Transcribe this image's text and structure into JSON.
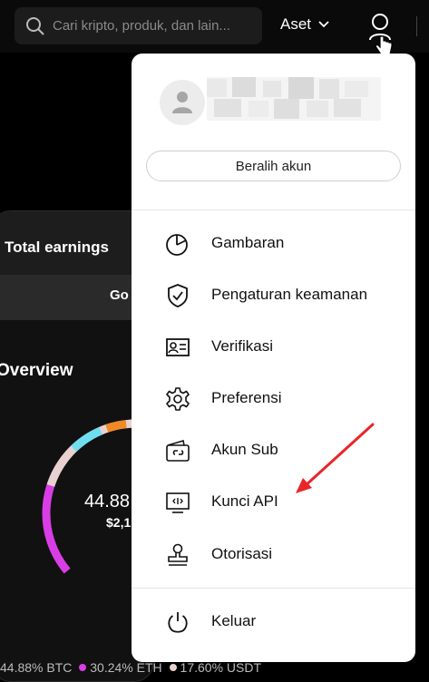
{
  "header": {
    "search_placeholder": "Cari kripto, produk, dan lain...",
    "assets_label": "Aset"
  },
  "background_card": {
    "title": "Total earnings",
    "go_label": "Go",
    "overview_label": "Overview",
    "center_percent": "44.88",
    "center_value": "$2,1",
    "legend": [
      {
        "label": "44.88% BTC",
        "color": "#e8d2cf"
      },
      {
        "label": "30.24% ETH",
        "color": "#d83ee6"
      },
      {
        "label": "17.60% USDT",
        "color": "#e8d2cf"
      }
    ]
  },
  "account_menu": {
    "switch_account_label": "Beralih akun",
    "items": [
      {
        "label": "Gambaran",
        "icon": "pie-chart-icon"
      },
      {
        "label": "Pengaturan keamanan",
        "icon": "shield-icon"
      },
      {
        "label": "Verifikasi",
        "icon": "id-card-icon"
      },
      {
        "label": "Preferensi",
        "icon": "gear-icon"
      },
      {
        "label": "Akun Sub",
        "icon": "wallet-link-icon"
      },
      {
        "label": "Kunci API",
        "icon": "api-monitor-icon"
      },
      {
        "label": "Otorisasi",
        "icon": "stamp-icon"
      }
    ],
    "logout_label": "Keluar"
  },
  "colors": {
    "annotation_arrow": "#e8262a",
    "ring": [
      "#e8d2cf",
      "#d83ee6",
      "#6ce0f0",
      "#f08a24"
    ]
  }
}
